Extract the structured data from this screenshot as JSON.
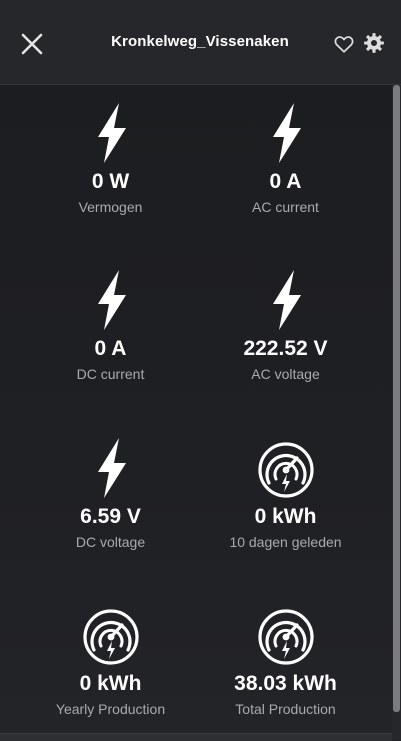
{
  "header": {
    "title": "Kronkelweg_Vissenaken"
  },
  "tiles": [
    {
      "value": "0 W",
      "label": "Vermogen",
      "icon": "lightning-icon"
    },
    {
      "value": "0 A",
      "label": "AC current",
      "icon": "lightning-icon"
    },
    {
      "value": "0 A",
      "label": "DC current",
      "icon": "lightning-icon"
    },
    {
      "value": "222.52 V",
      "label": "AC voltage",
      "icon": "lightning-icon"
    },
    {
      "value": "6.59 V",
      "label": "DC voltage",
      "icon": "lightning-icon"
    },
    {
      "value": "0 kWh",
      "label": "10 dagen geleden",
      "icon": "energy-meter-icon"
    },
    {
      "value": "0 kWh",
      "label": "Yearly Production",
      "icon": "energy-meter-icon"
    },
    {
      "value": "38.03 kWh",
      "label": "Total Production",
      "icon": "energy-meter-icon"
    }
  ],
  "colors": {
    "background": "#1f2023",
    "header": "#26272a",
    "text": "#ffffff",
    "label": "#a9aaad"
  }
}
